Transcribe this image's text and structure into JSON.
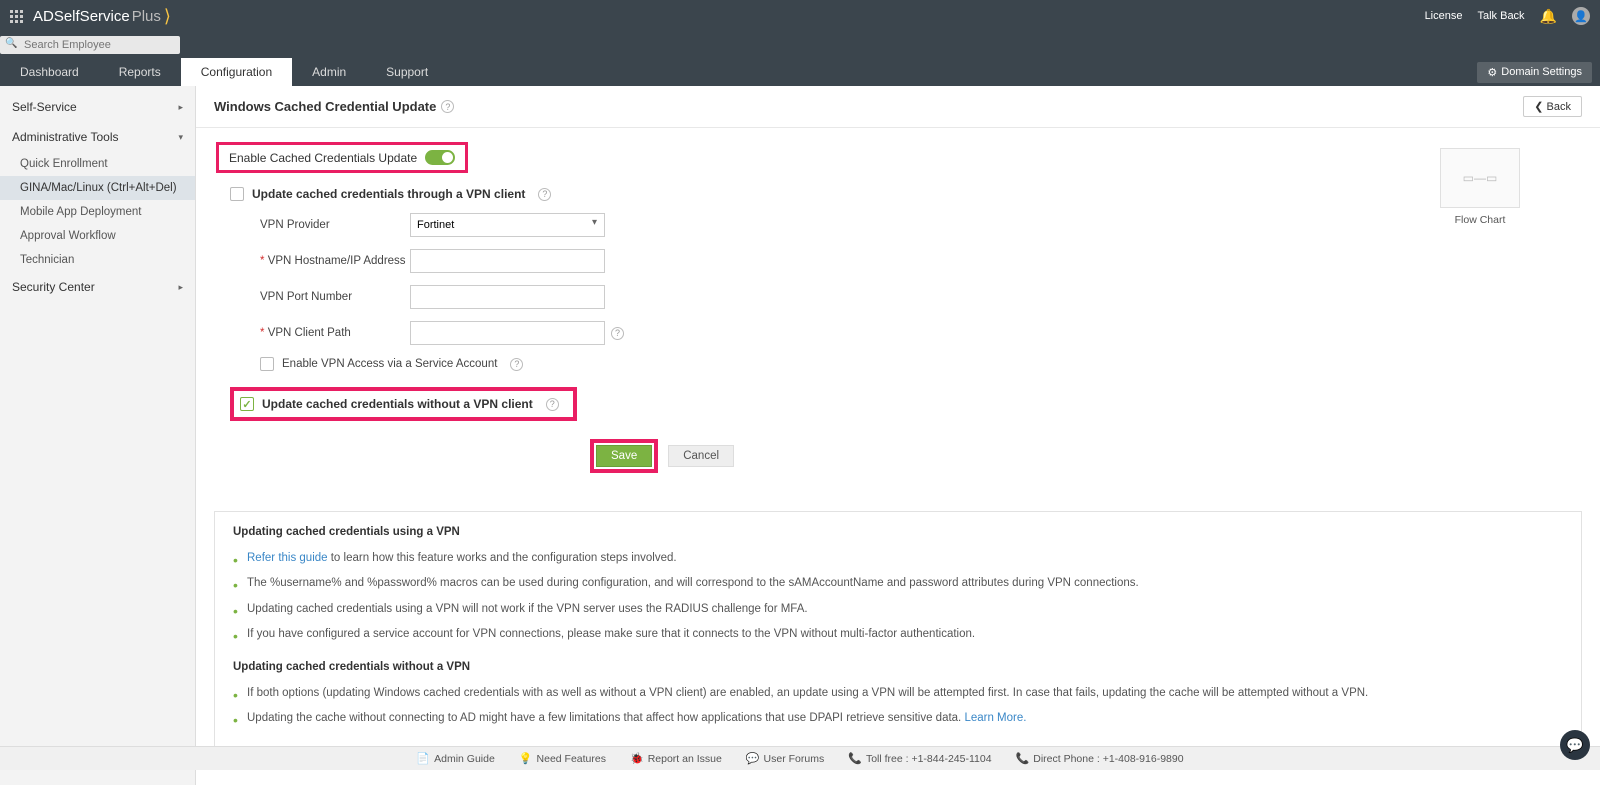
{
  "header": {
    "logo_main": "ADSelfService",
    "logo_suffix": " Plus",
    "links": {
      "license": "License",
      "talkback": "Talk Back"
    },
    "search_placeholder": "Search Employee"
  },
  "tabs": [
    "Dashboard",
    "Reports",
    "Configuration",
    "Admin",
    "Support"
  ],
  "domain_settings": "Domain Settings",
  "sidebar": {
    "self_service": "Self-Service",
    "admin_tools": "Administrative Tools",
    "items": [
      "Quick Enrollment",
      "GINA/Mac/Linux (Ctrl+Alt+Del)",
      "Mobile App Deployment",
      "Approval Workflow",
      "Technician"
    ],
    "security": "Security Center"
  },
  "page": {
    "title": "Windows Cached Credential Update",
    "back": "Back",
    "enable_label": "Enable Cached Credentials Update",
    "vpn_check": "Update cached credentials through a VPN client",
    "novpn_check": "Update cached credentials without a VPN client",
    "fields": {
      "provider": "VPN Provider",
      "provider_value": "Fortinet",
      "hostname": "VPN Hostname/IP Address",
      "port": "VPN Port Number",
      "clientpath": "VPN Client Path",
      "svc_account": "Enable VPN Access via a Service Account"
    },
    "flow_chart": "Flow Chart",
    "save": "Save",
    "cancel": "Cancel"
  },
  "info": {
    "title1": "Updating cached credentials using a VPN",
    "b1a": "Refer this guide",
    "b1b": " to learn how this feature works and the configuration steps involved.",
    "b2": "The %username% and %password% macros can be used during configuration, and will correspond to the sAMAccountName and password attributes during VPN connections.",
    "b3": "Updating cached credentials using a VPN will not work if the VPN server uses the RADIUS challenge for MFA.",
    "b4": "If you have configured a service account for VPN connections, please make sure that it connects to the VPN without multi-factor authentication.",
    "title2": "Updating cached credentials without a VPN",
    "b5": "If both options (updating Windows cached credentials with as well as without a VPN client) are enabled, an update using a VPN will be attempted first. In case that fails, updating the cache will be attempted without a VPN.",
    "b6a": "Updating the cache without connecting to AD might have a few limitations that affect how applications that use DPAPI retrieve sensitive data. ",
    "b6b": "Learn More."
  },
  "footer": {
    "admin_guide": "Admin Guide",
    "need_features": "Need Features",
    "report_issue": "Report an Issue",
    "user_forums": "User Forums",
    "toll_free": "Toll free : +1-844-245-1104",
    "direct": "Direct Phone : +1-408-916-9890"
  }
}
